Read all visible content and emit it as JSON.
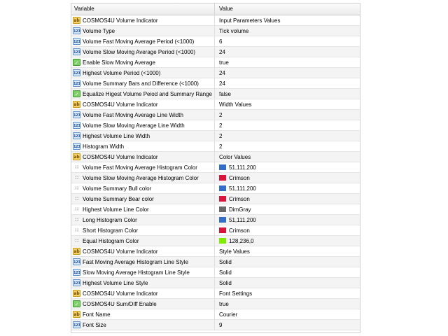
{
  "header": {
    "variable_label": "Variable",
    "value_label": "Value"
  },
  "rows": [
    {
      "icon": "string-icon",
      "variable": "COSMOS4U Volume Indicator",
      "value": "Input Parameters Values"
    },
    {
      "icon": "integer-icon",
      "variable": "Volume Type",
      "value": "Tick volume"
    },
    {
      "icon": "integer-icon",
      "variable": "Volume Fast Moving Average Period (<1000)",
      "value": "6"
    },
    {
      "icon": "integer-icon",
      "variable": "Volume Slow Moving Average Period (<1000)",
      "value": "24"
    },
    {
      "icon": "boolean-icon",
      "variable": "Enable Slow Moving Average",
      "value": "true"
    },
    {
      "icon": "integer-icon",
      "variable": "Highest Volume Period (<1000)",
      "value": "24"
    },
    {
      "icon": "integer-icon",
      "variable": "Volume Summary Bars and Difference (<1000)",
      "value": "24"
    },
    {
      "icon": "boolean-icon",
      "variable": "Equalize Higest Volume Peiod and Summary Range",
      "value": "false"
    },
    {
      "icon": "string-icon",
      "variable": "COSMOS4U Volume Indicator",
      "value": "Width Values"
    },
    {
      "icon": "integer-icon",
      "variable": "Volume Fast Moving Average Line Width",
      "value": "2"
    },
    {
      "icon": "integer-icon",
      "variable": "Volume Slow Moving Average Line Width",
      "value": "2"
    },
    {
      "icon": "integer-icon",
      "variable": "Highest Volume Line Width",
      "value": "2"
    },
    {
      "icon": "integer-icon",
      "variable": "Histogram Width",
      "value": "2"
    },
    {
      "icon": "string-icon",
      "variable": "COSMOS4U Volume Indicator",
      "value": "Color Values"
    },
    {
      "icon": "color-icon",
      "variable": "Volume Fast Moving Average Histogram Color",
      "value": "51,111,200",
      "swatch": "#336fc8"
    },
    {
      "icon": "color-icon",
      "variable": "Volume Slow Moving Average Histogram Color",
      "value": "Crimson",
      "swatch": "#dc143c"
    },
    {
      "icon": "color-icon",
      "variable": "Volume Summary Bull color",
      "value": "51,111,200",
      "swatch": "#336fc8"
    },
    {
      "icon": "color-icon",
      "variable": "Volume Summary Bear color",
      "value": "Crimson",
      "swatch": "#dc143c"
    },
    {
      "icon": "color-icon",
      "variable": "Highest Volume Line Color",
      "value": "DimGray",
      "swatch": "#696969"
    },
    {
      "icon": "color-icon",
      "variable": "Long Histogram Color",
      "value": "51,111,200",
      "swatch": "#336fc8"
    },
    {
      "icon": "color-icon",
      "variable": "Short Histogram Color",
      "value": "Crimson",
      "swatch": "#dc143c"
    },
    {
      "icon": "color-icon",
      "variable": "Equal Histogram Color",
      "value": "128,236,0",
      "swatch": "#80ec00"
    },
    {
      "icon": "string-icon",
      "variable": "COSMOS4U Volume Indicator",
      "value": "Style Values"
    },
    {
      "icon": "integer-icon",
      "variable": "Fast Moving Average Histogram Line Style",
      "value": "Solid"
    },
    {
      "icon": "integer-icon",
      "variable": "Slow Moving Average Histogram Line Style",
      "value": "Solid"
    },
    {
      "icon": "integer-icon",
      "variable": "Highest Volume Line Style",
      "value": "Solid"
    },
    {
      "icon": "string-icon",
      "variable": "COSMOS4U Volume Indicator",
      "value": "Font Settings"
    },
    {
      "icon": "boolean-icon",
      "variable": "COSMOS4U Sum/Diff Enable",
      "value": "true"
    },
    {
      "icon": "string-icon",
      "variable": "Font Name",
      "value": "Courier"
    },
    {
      "icon": "integer-icon",
      "variable": "Font Size",
      "value": "9"
    }
  ]
}
